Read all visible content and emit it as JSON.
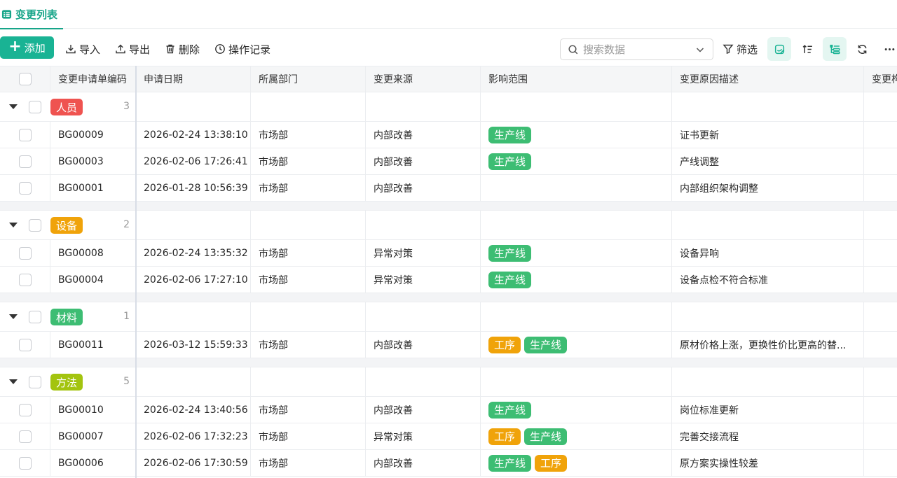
{
  "tab": {
    "title": "变更列表"
  },
  "toolbar": {
    "add_label": "添加",
    "import_label": "导入",
    "export_label": "导出",
    "delete_label": "删除",
    "log_label": "操作记录",
    "search_placeholder": "搜索数据",
    "filter_label": "筛选",
    "accent_color": "#19b394"
  },
  "table": {
    "columns": [
      "变更申请单编码",
      "申请日期",
      "所属部门",
      "变更来源",
      "影响范围",
      "变更原因描述",
      "变更构"
    ],
    "groups": [
      {
        "label": "人员",
        "count": "3",
        "color": "#ef5350",
        "rows": [
          {
            "code": "BG00009",
            "date": "2026-02-24 13:38:10",
            "dept": "市场部",
            "source": "内部改善",
            "scope": [
              {
                "text": "生产线",
                "color": "#3dbd73"
              }
            ],
            "reason": "证书更新"
          },
          {
            "code": "BG00003",
            "date": "2026-02-06 17:26:41",
            "dept": "市场部",
            "source": "内部改善",
            "scope": [
              {
                "text": "生产线",
                "color": "#3dbd73"
              }
            ],
            "reason": "产线调整"
          },
          {
            "code": "BG00001",
            "date": "2026-01-28 10:56:39",
            "dept": "市场部",
            "source": "内部改善",
            "scope": [],
            "reason": "内部组织架构调整"
          }
        ]
      },
      {
        "label": "设备",
        "count": "2",
        "color": "#f0a30a",
        "rows": [
          {
            "code": "BG00008",
            "date": "2026-02-24 13:35:32",
            "dept": "市场部",
            "source": "异常对策",
            "scope": [
              {
                "text": "生产线",
                "color": "#3dbd73"
              }
            ],
            "reason": "设备异响"
          },
          {
            "code": "BG00004",
            "date": "2026-02-06 17:27:10",
            "dept": "市场部",
            "source": "异常对策",
            "scope": [
              {
                "text": "生产线",
                "color": "#3dbd73"
              }
            ],
            "reason": "设备点检不符合标准"
          }
        ]
      },
      {
        "label": "材料",
        "count": "1",
        "color": "#3dbd73",
        "rows": [
          {
            "code": "BG00011",
            "date": "2026-03-12 15:59:33",
            "dept": "市场部",
            "source": "内部改善",
            "scope": [
              {
                "text": "工序",
                "color": "#f0a30a"
              },
              {
                "text": "生产线",
                "color": "#3dbd73"
              }
            ],
            "reason": "原材价格上涨，更换性价比更高的替..."
          }
        ]
      },
      {
        "label": "方法",
        "count": "5",
        "color": "#a3c40f",
        "rows": [
          {
            "code": "BG00010",
            "date": "2026-02-24 13:40:56",
            "dept": "市场部",
            "source": "内部改善",
            "scope": [
              {
                "text": "生产线",
                "color": "#3dbd73"
              }
            ],
            "reason": "岗位标准更新"
          },
          {
            "code": "BG00007",
            "date": "2026-02-06 17:32:23",
            "dept": "市场部",
            "source": "异常对策",
            "scope": [
              {
                "text": "工序",
                "color": "#f0a30a"
              },
              {
                "text": "生产线",
                "color": "#3dbd73"
              }
            ],
            "reason": "完善交接流程"
          },
          {
            "code": "BG00006",
            "date": "2026-02-06 17:30:59",
            "dept": "市场部",
            "source": "内部改善",
            "scope": [
              {
                "text": "生产线",
                "color": "#3dbd73"
              },
              {
                "text": "工序",
                "color": "#f0a30a"
              }
            ],
            "reason": "原方案实操性较差"
          }
        ]
      }
    ]
  }
}
